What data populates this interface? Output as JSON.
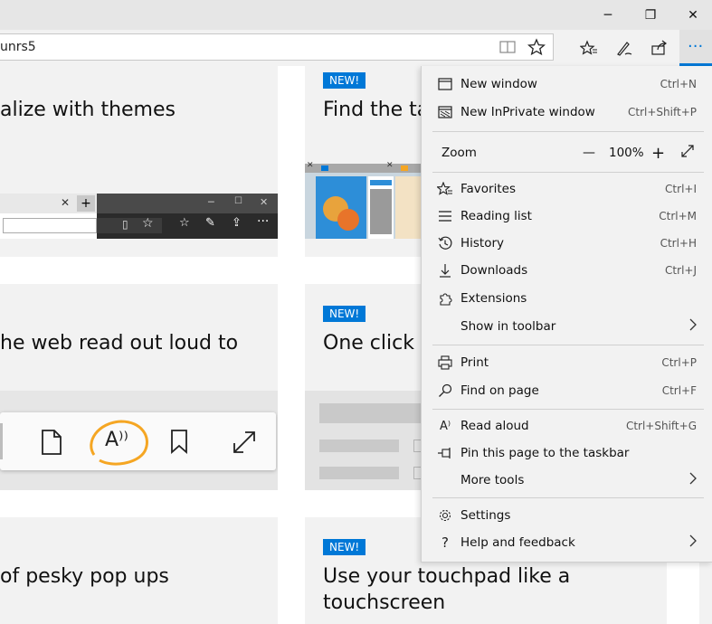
{
  "window": {
    "minimize": "─",
    "restore": "❐",
    "close": "✕"
  },
  "address_bar": {
    "value": "unrs5"
  },
  "toolbar_icons": [
    "reading-view-icon",
    "favorite-star-icon",
    "favorites-hub-icon",
    "make-note-icon",
    "share-icon",
    "more-icon"
  ],
  "cards": {
    "c1": {
      "title": "alize with themes"
    },
    "c2": {
      "badge": "NEW!",
      "title": "Find the ta"
    },
    "c3": {
      "title": "he web read out loud to"
    },
    "c4": {
      "badge": "NEW!",
      "title": "One click t"
    },
    "c5": {
      "title": " of pesky pop ups"
    },
    "c6": {
      "badge": "NEW!",
      "title_line1": "Use your touchpad like a",
      "title_line2": "touchscreen"
    }
  },
  "mini_browser": {
    "more": "···"
  },
  "reading_toolbar": {
    "read_aloud_glyph": "A⁾⁾"
  },
  "menu": {
    "new_window": {
      "label": "New window",
      "shortcut": "Ctrl+N"
    },
    "new_inprivate": {
      "label": "New InPrivate window",
      "shortcut": "Ctrl+Shift+P"
    },
    "zoom": {
      "label": "Zoom",
      "minus": "—",
      "value": "100%",
      "plus": "+"
    },
    "favorites": {
      "label": "Favorites",
      "shortcut": "Ctrl+I"
    },
    "reading_list": {
      "label": "Reading list",
      "shortcut": "Ctrl+M"
    },
    "history": {
      "label": "History",
      "shortcut": "Ctrl+H"
    },
    "downloads": {
      "label": "Downloads",
      "shortcut": "Ctrl+J"
    },
    "extensions": {
      "label": "Extensions"
    },
    "show_in_toolbar": {
      "label": "Show in toolbar"
    },
    "print": {
      "label": "Print",
      "shortcut": "Ctrl+P"
    },
    "find_on_page": {
      "label": "Find on page",
      "shortcut": "Ctrl+F"
    },
    "read_aloud": {
      "label": "Read aloud",
      "shortcut": "Ctrl+Shift+G"
    },
    "pin_taskbar": {
      "label": "Pin this page to the taskbar"
    },
    "more_tools": {
      "label": "More tools"
    },
    "settings": {
      "label": "Settings"
    },
    "help": {
      "label": "Help and feedback"
    }
  },
  "colors": {
    "accent": "#0078d7",
    "highlight_ring": "#f5a623"
  }
}
